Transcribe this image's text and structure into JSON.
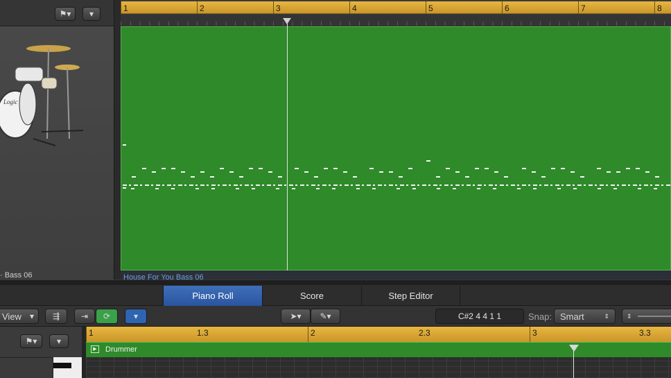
{
  "top_ruler": {
    "bars": [
      "1",
      "2",
      "3",
      "4",
      "5",
      "6",
      "7",
      "8"
    ]
  },
  "region": {
    "name": "House For You Bass 06"
  },
  "left_panel": {
    "track_label": "· Bass 06"
  },
  "tabs": [
    {
      "label": "Piano Roll",
      "active": true
    },
    {
      "label": "Score",
      "active": false
    },
    {
      "label": "Step Editor",
      "active": false
    }
  ],
  "toolbar": {
    "view_label": "View",
    "position": "C#2   4 4 1 1",
    "snap_label": "Snap:",
    "snap_value": "Smart"
  },
  "bottom_ruler": {
    "labels": [
      "1",
      "1.3",
      "2",
      "2.3",
      "3",
      "3.3"
    ]
  },
  "bottom_region": {
    "name": "Drummer"
  },
  "colors": {
    "region_green": "#2f8a2a",
    "ruler_gold": "#e0ad3a",
    "active_tab_blue": "#2f5fae"
  }
}
